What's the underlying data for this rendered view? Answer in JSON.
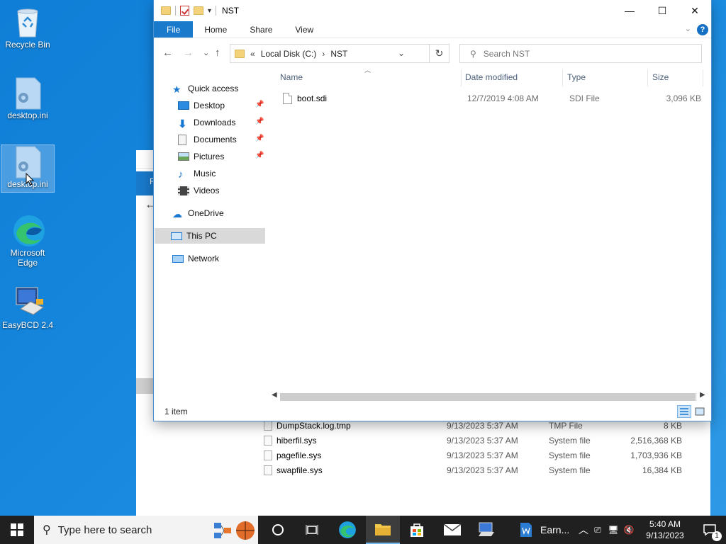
{
  "desktop": {
    "icons": [
      {
        "label": "Recycle Bin"
      },
      {
        "label": "desktop.ini"
      },
      {
        "label": "desktop.ini"
      },
      {
        "label": "Microsoft Edge"
      },
      {
        "label": "EasyBCD 2.4"
      }
    ]
  },
  "background_window": {
    "ribbon_letter": "F",
    "files": [
      {
        "name": "DumpStack.log.tmp",
        "date": "9/13/2023 5:37 AM",
        "type": "TMP File",
        "size": "8 KB"
      },
      {
        "name": "hiberfil.sys",
        "date": "9/13/2023 5:37 AM",
        "type": "System file",
        "size": "2,516,368 KB"
      },
      {
        "name": "pagefile.sys",
        "date": "9/13/2023 5:37 AM",
        "type": "System file",
        "size": "1,703,936 KB"
      },
      {
        "name": "swapfile.sys",
        "date": "9/13/2023 5:37 AM",
        "type": "System file",
        "size": "16,384 KB"
      }
    ]
  },
  "window": {
    "title": "NST",
    "controls": {
      "minimize": "—",
      "maximize": "☐",
      "close": "✕"
    },
    "ribbon_tabs": [
      "File",
      "Home",
      "Share",
      "View"
    ],
    "help": "?",
    "address": {
      "prefix": "«",
      "parts": [
        "Local Disk (C:)",
        "NST"
      ]
    },
    "search_placeholder": "Search NST",
    "nav": {
      "quick_access": "Quick access",
      "pinned": [
        "Desktop",
        "Downloads",
        "Documents",
        "Pictures"
      ],
      "unpinned": [
        "Music",
        "Videos"
      ],
      "onedrive": "OneDrive",
      "this_pc": "This PC",
      "network": "Network"
    },
    "columns": {
      "name": "Name",
      "date": "Date modified",
      "type": "Type",
      "size": "Size"
    },
    "files": [
      {
        "name": "boot.sdi",
        "date": "12/7/2019 4:08 AM",
        "type": "SDI File",
        "size": "3,096 KB"
      }
    ],
    "status": "1 item"
  },
  "taskbar": {
    "search_placeholder": "Type here to search",
    "word_label": "Earn...",
    "time": "5:40 AM",
    "date": "9/13/2023",
    "notification_count": "1"
  },
  "colors": {
    "accent": "#1979ca",
    "desktop": "#1a8be0",
    "taskbar": "#202020"
  }
}
